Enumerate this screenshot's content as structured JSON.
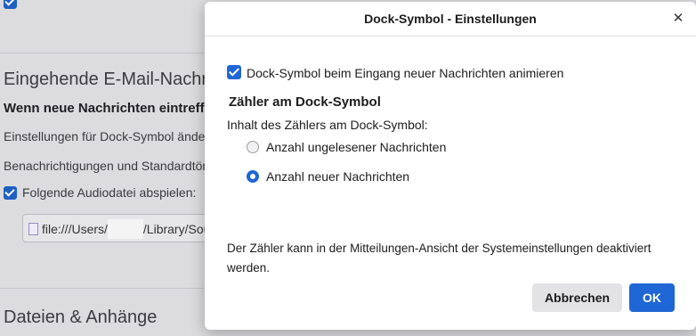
{
  "background": {
    "section_incoming": "Eingehende E-Mail-Nachrichten",
    "subheading": "Wenn neue Nachrichten eintreffen",
    "line1": "Einstellungen für Dock-Symbol ändern",
    "line2": "Benachrichtigungen und Standardtöne",
    "audio_checkbox_label": "Folgende Audiodatei abspielen:",
    "audio_path_prefix": "file:///Users/",
    "audio_path_suffix": "/Library/Sounds",
    "section_files": "Dateien & Anhänge"
  },
  "dialog": {
    "title": "Dock-Symbol - Einstellungen",
    "animate_checkbox_label": "Dock-Symbol beim Eingang neuer Nachrichten animieren",
    "animate_checked": true,
    "counter_heading": "Zähler am Dock-Symbol",
    "counter_content_label": "Inhalt des Zählers am Dock-Symbol:",
    "options": [
      {
        "label": "Anzahl ungelesener Nachrichten",
        "selected": false
      },
      {
        "label": "Anzahl neuer Nachrichten",
        "selected": true
      }
    ],
    "note": "Der Zähler kann in der Mitteilungen-Ansicht der Systemeinstellungen deaktiviert werden.",
    "cancel_label": "Abbrechen",
    "ok_label": "OK",
    "close_glyph": "✕"
  },
  "colors": {
    "accent": "#1f66d6",
    "overlay": "#dcdcdf"
  }
}
